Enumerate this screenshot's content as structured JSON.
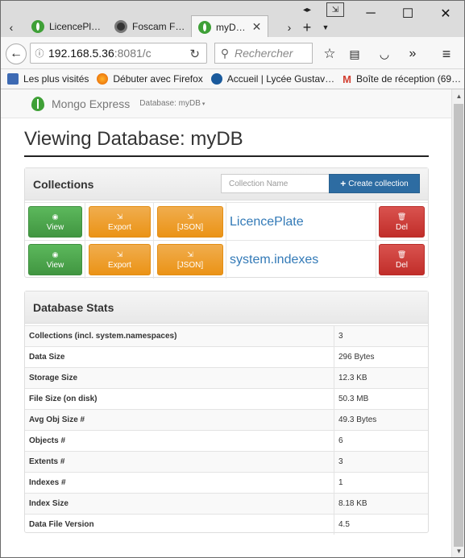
{
  "browser": {
    "tabs": [
      {
        "label": "LicencePl…",
        "icon": "mongo-leaf-icon",
        "active": false
      },
      {
        "label": "Foscam F…",
        "icon": "camera-icon",
        "active": false
      },
      {
        "label": "myD…",
        "icon": "mongo-leaf-icon",
        "active": true
      }
    ],
    "url_host": "192.168.5.36",
    "url_path": ":8081/c",
    "search_placeholder": "Rechercher",
    "bookmarks": [
      {
        "label": "Les plus visités",
        "icon": "bookmark-icon"
      },
      {
        "label": "Débuter avec Firefox",
        "icon": "firefox-icon"
      },
      {
        "label": "Accueil | Lycée Gustav…",
        "icon": "lycee-icon"
      },
      {
        "label": "Boîte de réception (69…",
        "icon": "gmail-icon"
      }
    ]
  },
  "app": {
    "brand": "Mongo Express",
    "db_menu": "Database: myDB",
    "heading": "Viewing Database: myDB"
  },
  "collections": {
    "title": "Collections",
    "input_placeholder": "Collection Name",
    "create_label": "Create collection",
    "view_label": "View",
    "export_label": "Export",
    "json_label": "[JSON]",
    "del_label": "Del",
    "items": [
      {
        "name": "LicencePlate"
      },
      {
        "name": "system.indexes"
      }
    ]
  },
  "stats": {
    "title": "Database Stats",
    "rows": [
      {
        "key": "Collections (incl. system.namespaces)",
        "value": "3"
      },
      {
        "key": "Data Size",
        "value": "296 Bytes"
      },
      {
        "key": "Storage Size",
        "value": "12.3 KB"
      },
      {
        "key": "File Size (on disk)",
        "value": "50.3 MB"
      },
      {
        "key": "Avg Obj Size #",
        "value": "49.3 Bytes"
      },
      {
        "key": "Objects #",
        "value": "6"
      },
      {
        "key": "Extents #",
        "value": "3"
      },
      {
        "key": "Indexes #",
        "value": "1"
      },
      {
        "key": "Index Size",
        "value": "8.18 KB"
      },
      {
        "key": "Data File Version",
        "value": "4.5"
      }
    ]
  },
  "colors": {
    "green": "#5cb85c",
    "orange": "#f0ad4e",
    "red": "#d9534f",
    "primary": "#2d6ca2",
    "link": "#337ab7"
  }
}
